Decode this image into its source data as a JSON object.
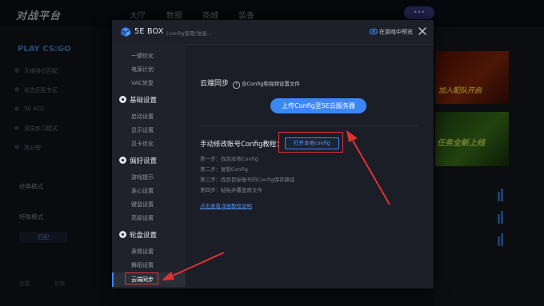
{
  "background": {
    "logo": "对战平台",
    "nav": [
      "大厅",
      "数据",
      "商城",
      "装备"
    ],
    "play_label": "PLAY CS:GO",
    "sidebar_items": [
      "天梯排位匹配",
      "优先匹配专区",
      "5E ACE",
      "竞技练习模式",
      "高分榜"
    ],
    "modes": [
      "经典模式",
      "特殊模式"
    ],
    "mode_button": "匹配",
    "banner1_text": "加入配队开启",
    "banner2_text": "任务全新上线",
    "bottom_items": [
      "设置",
      "反馈"
    ]
  },
  "modal": {
    "title": "5E BOX",
    "subtitle": "(config管理/准星...",
    "preview_label": "在游戏中预览",
    "menu": {
      "items": [
        {
          "type": "item",
          "label": "一键优化"
        },
        {
          "type": "item",
          "label": "电源计划"
        },
        {
          "type": "item",
          "label": "VAC修复"
        },
        {
          "type": "category",
          "label": "基础设置"
        },
        {
          "type": "item",
          "label": "启动设置"
        },
        {
          "type": "item",
          "label": "显示设置"
        },
        {
          "type": "item",
          "label": "显卡优化"
        },
        {
          "type": "category",
          "label": "偏好设置"
        },
        {
          "type": "item",
          "label": "游戏提示"
        },
        {
          "type": "item",
          "label": "准心设置"
        },
        {
          "type": "item",
          "label": "键鼠设置"
        },
        {
          "type": "item",
          "label": "高级设置"
        },
        {
          "type": "category",
          "label": "轮盘设置"
        },
        {
          "type": "item",
          "label": "表情设置"
        },
        {
          "type": "item",
          "label": "舞蹈设置"
        }
      ],
      "active_label": "云端同步"
    },
    "content": {
      "section_title": "云端同步",
      "section_hint": "含Config和视频设置文件",
      "upload_button": "上传Config至5E云服务器",
      "manual_title": "手动修改账号Config教程：",
      "open_button": "打开本地config",
      "steps": [
        "第一步：找到本地Config",
        "第二步：复制Config",
        "第三步：找到目标账号的Config保存路径",
        "第四步：粘贴并覆盖原文件"
      ],
      "tutorial_link": "点击查看详细教程说明"
    }
  },
  "colors": {
    "accent": "#3b87f5",
    "highlight": "#e03232",
    "modal_bg": "#1b1e26"
  }
}
